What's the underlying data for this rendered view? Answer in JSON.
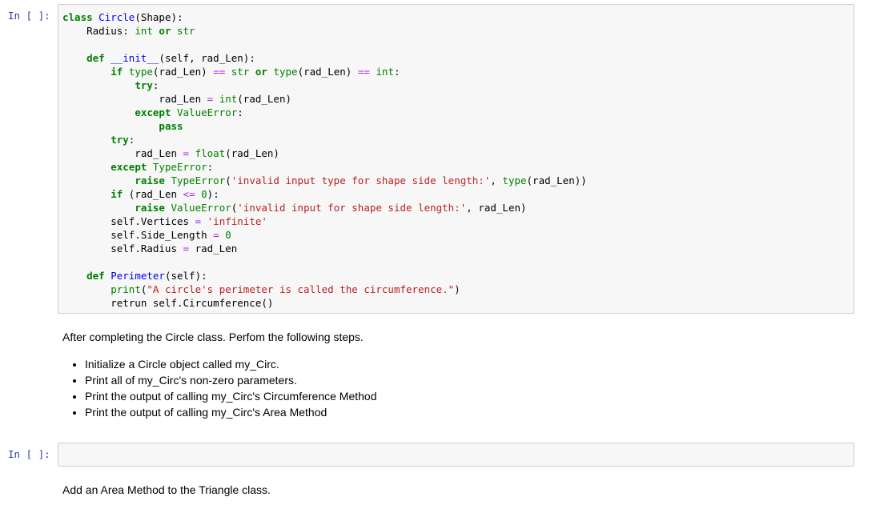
{
  "cells": {
    "cell1_prompt": "In [ ]:",
    "cell2_prompt": "In [ ]:"
  },
  "code_lines": [
    "class Circle(Shape):",
    "    Radius: int or str",
    "",
    "    def __init__(self, rad_Len):",
    "        if type(rad_Len) == str or type(rad_Len) == int:",
    "            try:",
    "                rad_Len = int(rad_Len)",
    "            except ValueError:",
    "                pass",
    "        try:",
    "            rad_Len = float(rad_Len)",
    "        except TypeError:",
    "            raise TypeError('invalid input type for shape side length:', type(rad_Len))",
    "        if (rad_Len <= 0):",
    "            raise ValueError('invalid input for shape side length:', rad_Len)",
    "        self.Vertices = 'infinite'",
    "        self.Side_Length = 0",
    "        self.Radius = rad_Len",
    "",
    "    def Perimeter(self):",
    "        print(\"A circle's perimeter is called the circumference.\")",
    "        retrun self.Circumference()"
  ],
  "markdown1": {
    "text": "After completing the Circle class. Perfom the following steps.",
    "steps": [
      "Initialize a Circle object called my_Circ.",
      "Print all of my_Circ's non-zero parameters.",
      "Print the output of calling my_Circ's Circumference Method",
      "Print the output of calling my_Circ's Area Method"
    ]
  },
  "markdown2": {
    "text": "Add an Area Method to the Triangle class."
  }
}
